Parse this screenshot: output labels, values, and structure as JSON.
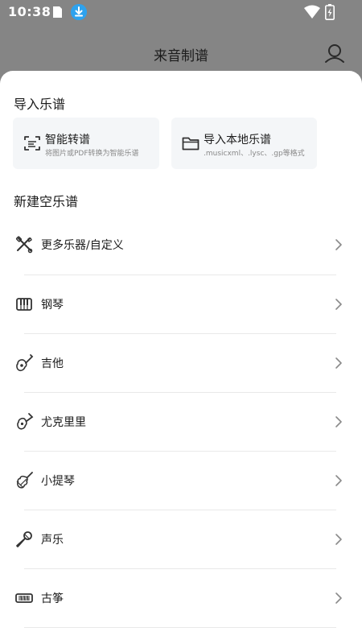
{
  "status_bar": {
    "time": "10:38"
  },
  "app_bar": {
    "title": "来音制谱"
  },
  "import_section": {
    "title": "导入乐谱",
    "cards": [
      {
        "title": "智能转谱",
        "subtitle": "将图片或PDF转换为智能乐谱",
        "icon": "scan-icon"
      },
      {
        "title": "导入本地乐谱",
        "subtitle": ".musicxml、.lysc、.gp等格式",
        "icon": "folder-icon"
      }
    ]
  },
  "new_section": {
    "title": "新建空乐谱",
    "items": [
      {
        "label": "更多乐器/自定义",
        "icon": "instruments-icon"
      },
      {
        "label": "钢琴",
        "icon": "piano-icon"
      },
      {
        "label": "吉他",
        "icon": "guitar-icon"
      },
      {
        "label": "尤克里里",
        "icon": "ukulele-icon"
      },
      {
        "label": "小提琴",
        "icon": "violin-icon"
      },
      {
        "label": "声乐",
        "icon": "microphone-icon"
      },
      {
        "label": "古筝",
        "icon": "guzheng-icon"
      }
    ]
  },
  "colors": {
    "overlay": "#858585",
    "sheet": "#ffffff",
    "card": "#f4f6f8",
    "download_badge": "#2ea2ee"
  }
}
